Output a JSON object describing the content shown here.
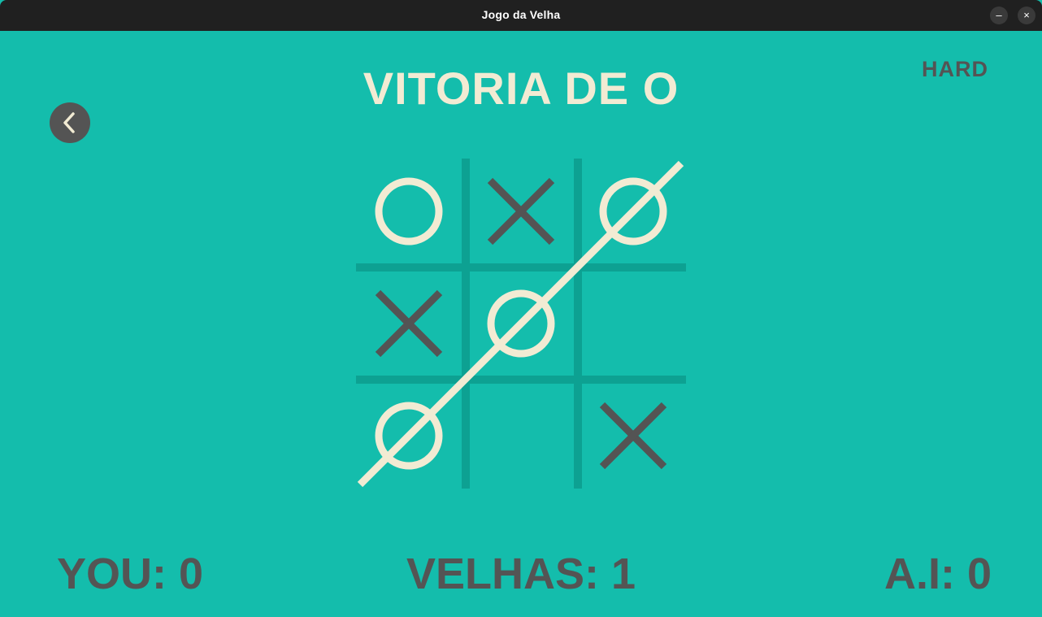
{
  "window": {
    "title": "Jogo da Velha",
    "minimize_label": "–",
    "close_label": "×"
  },
  "game": {
    "status": "VITORIA DE O",
    "difficulty": "HARD",
    "board": [
      [
        "O",
        "X",
        "O"
      ],
      [
        "X",
        "O",
        ""
      ],
      [
        "O",
        "",
        "X"
      ]
    ],
    "winning_line": "diagonal bottom-left to top-right"
  },
  "scores": {
    "you": "YOU: 0",
    "velhas": "VELHAS: 1",
    "ai": "A.I: 0"
  },
  "icons": {
    "back": "chevron-left-icon"
  },
  "colors": {
    "background": "#14bdac",
    "grid": "#0da192",
    "o_mark": "#f2ebd3",
    "x_mark": "#545454"
  }
}
